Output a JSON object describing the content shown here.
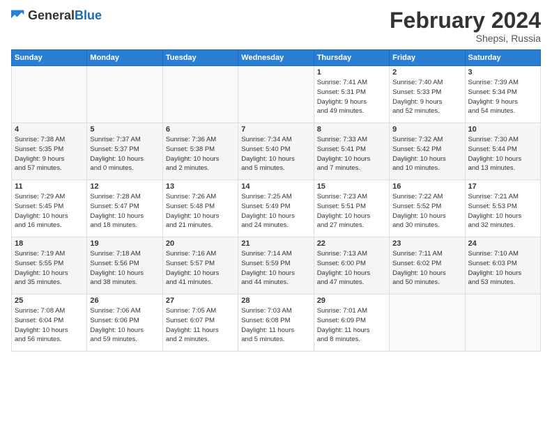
{
  "header": {
    "logo_general": "General",
    "logo_blue": "Blue",
    "month_title": "February 2024",
    "location": "Shepsi, Russia"
  },
  "days_of_week": [
    "Sunday",
    "Monday",
    "Tuesday",
    "Wednesday",
    "Thursday",
    "Friday",
    "Saturday"
  ],
  "weeks": [
    [
      {
        "day": "",
        "info": ""
      },
      {
        "day": "",
        "info": ""
      },
      {
        "day": "",
        "info": ""
      },
      {
        "day": "",
        "info": ""
      },
      {
        "day": "1",
        "info": "Sunrise: 7:41 AM\nSunset: 5:31 PM\nDaylight: 9 hours\nand 49 minutes."
      },
      {
        "day": "2",
        "info": "Sunrise: 7:40 AM\nSunset: 5:33 PM\nDaylight: 9 hours\nand 52 minutes."
      },
      {
        "day": "3",
        "info": "Sunrise: 7:39 AM\nSunset: 5:34 PM\nDaylight: 9 hours\nand 54 minutes."
      }
    ],
    [
      {
        "day": "4",
        "info": "Sunrise: 7:38 AM\nSunset: 5:35 PM\nDaylight: 9 hours\nand 57 minutes."
      },
      {
        "day": "5",
        "info": "Sunrise: 7:37 AM\nSunset: 5:37 PM\nDaylight: 10 hours\nand 0 minutes."
      },
      {
        "day": "6",
        "info": "Sunrise: 7:36 AM\nSunset: 5:38 PM\nDaylight: 10 hours\nand 2 minutes."
      },
      {
        "day": "7",
        "info": "Sunrise: 7:34 AM\nSunset: 5:40 PM\nDaylight: 10 hours\nand 5 minutes."
      },
      {
        "day": "8",
        "info": "Sunrise: 7:33 AM\nSunset: 5:41 PM\nDaylight: 10 hours\nand 7 minutes."
      },
      {
        "day": "9",
        "info": "Sunrise: 7:32 AM\nSunset: 5:42 PM\nDaylight: 10 hours\nand 10 minutes."
      },
      {
        "day": "10",
        "info": "Sunrise: 7:30 AM\nSunset: 5:44 PM\nDaylight: 10 hours\nand 13 minutes."
      }
    ],
    [
      {
        "day": "11",
        "info": "Sunrise: 7:29 AM\nSunset: 5:45 PM\nDaylight: 10 hours\nand 16 minutes."
      },
      {
        "day": "12",
        "info": "Sunrise: 7:28 AM\nSunset: 5:47 PM\nDaylight: 10 hours\nand 18 minutes."
      },
      {
        "day": "13",
        "info": "Sunrise: 7:26 AM\nSunset: 5:48 PM\nDaylight: 10 hours\nand 21 minutes."
      },
      {
        "day": "14",
        "info": "Sunrise: 7:25 AM\nSunset: 5:49 PM\nDaylight: 10 hours\nand 24 minutes."
      },
      {
        "day": "15",
        "info": "Sunrise: 7:23 AM\nSunset: 5:51 PM\nDaylight: 10 hours\nand 27 minutes."
      },
      {
        "day": "16",
        "info": "Sunrise: 7:22 AM\nSunset: 5:52 PM\nDaylight: 10 hours\nand 30 minutes."
      },
      {
        "day": "17",
        "info": "Sunrise: 7:21 AM\nSunset: 5:53 PM\nDaylight: 10 hours\nand 32 minutes."
      }
    ],
    [
      {
        "day": "18",
        "info": "Sunrise: 7:19 AM\nSunset: 5:55 PM\nDaylight: 10 hours\nand 35 minutes."
      },
      {
        "day": "19",
        "info": "Sunrise: 7:18 AM\nSunset: 5:56 PM\nDaylight: 10 hours\nand 38 minutes."
      },
      {
        "day": "20",
        "info": "Sunrise: 7:16 AM\nSunset: 5:57 PM\nDaylight: 10 hours\nand 41 minutes."
      },
      {
        "day": "21",
        "info": "Sunrise: 7:14 AM\nSunset: 5:59 PM\nDaylight: 10 hours\nand 44 minutes."
      },
      {
        "day": "22",
        "info": "Sunrise: 7:13 AM\nSunset: 6:00 PM\nDaylight: 10 hours\nand 47 minutes."
      },
      {
        "day": "23",
        "info": "Sunrise: 7:11 AM\nSunset: 6:02 PM\nDaylight: 10 hours\nand 50 minutes."
      },
      {
        "day": "24",
        "info": "Sunrise: 7:10 AM\nSunset: 6:03 PM\nDaylight: 10 hours\nand 53 minutes."
      }
    ],
    [
      {
        "day": "25",
        "info": "Sunrise: 7:08 AM\nSunset: 6:04 PM\nDaylight: 10 hours\nand 56 minutes."
      },
      {
        "day": "26",
        "info": "Sunrise: 7:06 AM\nSunset: 6:06 PM\nDaylight: 10 hours\nand 59 minutes."
      },
      {
        "day": "27",
        "info": "Sunrise: 7:05 AM\nSunset: 6:07 PM\nDaylight: 11 hours\nand 2 minutes."
      },
      {
        "day": "28",
        "info": "Sunrise: 7:03 AM\nSunset: 6:08 PM\nDaylight: 11 hours\nand 5 minutes."
      },
      {
        "day": "29",
        "info": "Sunrise: 7:01 AM\nSunset: 6:09 PM\nDaylight: 11 hours\nand 8 minutes."
      },
      {
        "day": "",
        "info": ""
      },
      {
        "day": "",
        "info": ""
      }
    ]
  ]
}
